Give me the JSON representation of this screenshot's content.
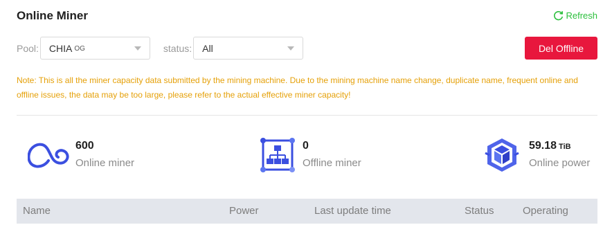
{
  "header": {
    "title": "Online Miner",
    "refresh_label": "Refresh"
  },
  "filters": {
    "pool_label": "Pool:",
    "pool_value": "CHIA",
    "pool_badge": "OG",
    "status_label": "status:",
    "status_value": "All"
  },
  "actions": {
    "del_offline_label": "Del Offline"
  },
  "note": "Note: This is all the miner capacity data submitted by the mining machine. Due to the mining machine name change, duplicate name, frequent online and offline issues, the data may be too large, please refer to the actual effective miner capacity!",
  "stats": {
    "online_miner": {
      "value": "600",
      "label": "Online miner",
      "icon": "infinity-cloud-icon"
    },
    "offline_miner": {
      "value": "0",
      "label": "Offline miner",
      "icon": "network-tree-icon"
    },
    "online_power": {
      "value": "59.18",
      "unit": "TiB",
      "label": "Online power",
      "icon": "cube-stack-icon"
    }
  },
  "table": {
    "columns": [
      "Name",
      "Power",
      "Last update time",
      "Status",
      "Operating"
    ]
  },
  "colors": {
    "accent_blue": "#3b4fe0",
    "danger": "#e8173d",
    "refresh_green": "#2bbf3c",
    "note_orange": "#e5a008"
  }
}
